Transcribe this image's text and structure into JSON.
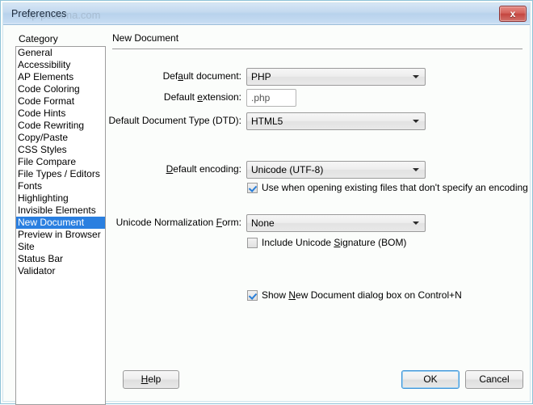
{
  "window": {
    "title": "Preferences",
    "watermark": "ttp.pcdama.com",
    "close_label": "x"
  },
  "sidebar": {
    "heading": "Category",
    "items": [
      {
        "label": "General",
        "selected": false
      },
      {
        "label": "Accessibility",
        "selected": false
      },
      {
        "label": "AP Elements",
        "selected": false
      },
      {
        "label": "Code Coloring",
        "selected": false
      },
      {
        "label": "Code Format",
        "selected": false
      },
      {
        "label": "Code Hints",
        "selected": false
      },
      {
        "label": "Code Rewriting",
        "selected": false
      },
      {
        "label": "Copy/Paste",
        "selected": false
      },
      {
        "label": "CSS Styles",
        "selected": false
      },
      {
        "label": "File Compare",
        "selected": false
      },
      {
        "label": "File Types / Editors",
        "selected": false
      },
      {
        "label": "Fonts",
        "selected": false
      },
      {
        "label": "Highlighting",
        "selected": false
      },
      {
        "label": "Invisible Elements",
        "selected": false
      },
      {
        "label": "New Document",
        "selected": true
      },
      {
        "label": "Preview in Browser",
        "selected": false
      },
      {
        "label": "Site",
        "selected": false
      },
      {
        "label": "Status Bar",
        "selected": false
      },
      {
        "label": "Validator",
        "selected": false
      }
    ]
  },
  "panel": {
    "title": "New Document",
    "fields": {
      "default_document": {
        "label_pre": "Def",
        "label_mnemonic": "a",
        "label_post": "ult document:",
        "value": "PHP"
      },
      "default_extension": {
        "label_pre": "Default ",
        "label_mnemonic": "e",
        "label_post": "xtension:",
        "value": ".php"
      },
      "default_dtd": {
        "label_pre": "Default Document Type (DTD):",
        "label_mnemonic": "",
        "label_post": "",
        "value": "HTML5"
      },
      "default_encoding": {
        "label_pre": "",
        "label_mnemonic": "D",
        "label_post": "efault encoding:",
        "value": "Unicode (UTF-8)"
      },
      "normalization_form": {
        "label_pre": "Unicode Normalization ",
        "label_mnemonic": "F",
        "label_post": "orm:",
        "value": "None"
      }
    },
    "checkboxes": {
      "use_when_opening": {
        "text": "Use when opening existing files that don't specify an encoding",
        "checked": true
      },
      "include_bom": {
        "text_pre": "Include Unicode ",
        "text_mnemonic": "S",
        "text_post": "ignature (BOM)",
        "checked": false
      },
      "show_new_doc_dialog": {
        "text_pre": "Show ",
        "text_mnemonic": "N",
        "text_post": "ew Document dialog box on Control+N",
        "checked": true
      }
    }
  },
  "footer": {
    "help_pre": "",
    "help_mnemonic": "H",
    "help_post": "elp",
    "ok_label": "OK",
    "cancel_label": "Cancel"
  },
  "colors": {
    "selection": "#2a7fe0",
    "titlebar": "#c3d9ef",
    "close_button": "#c4453f",
    "default_button_border": "#3c93d8"
  }
}
